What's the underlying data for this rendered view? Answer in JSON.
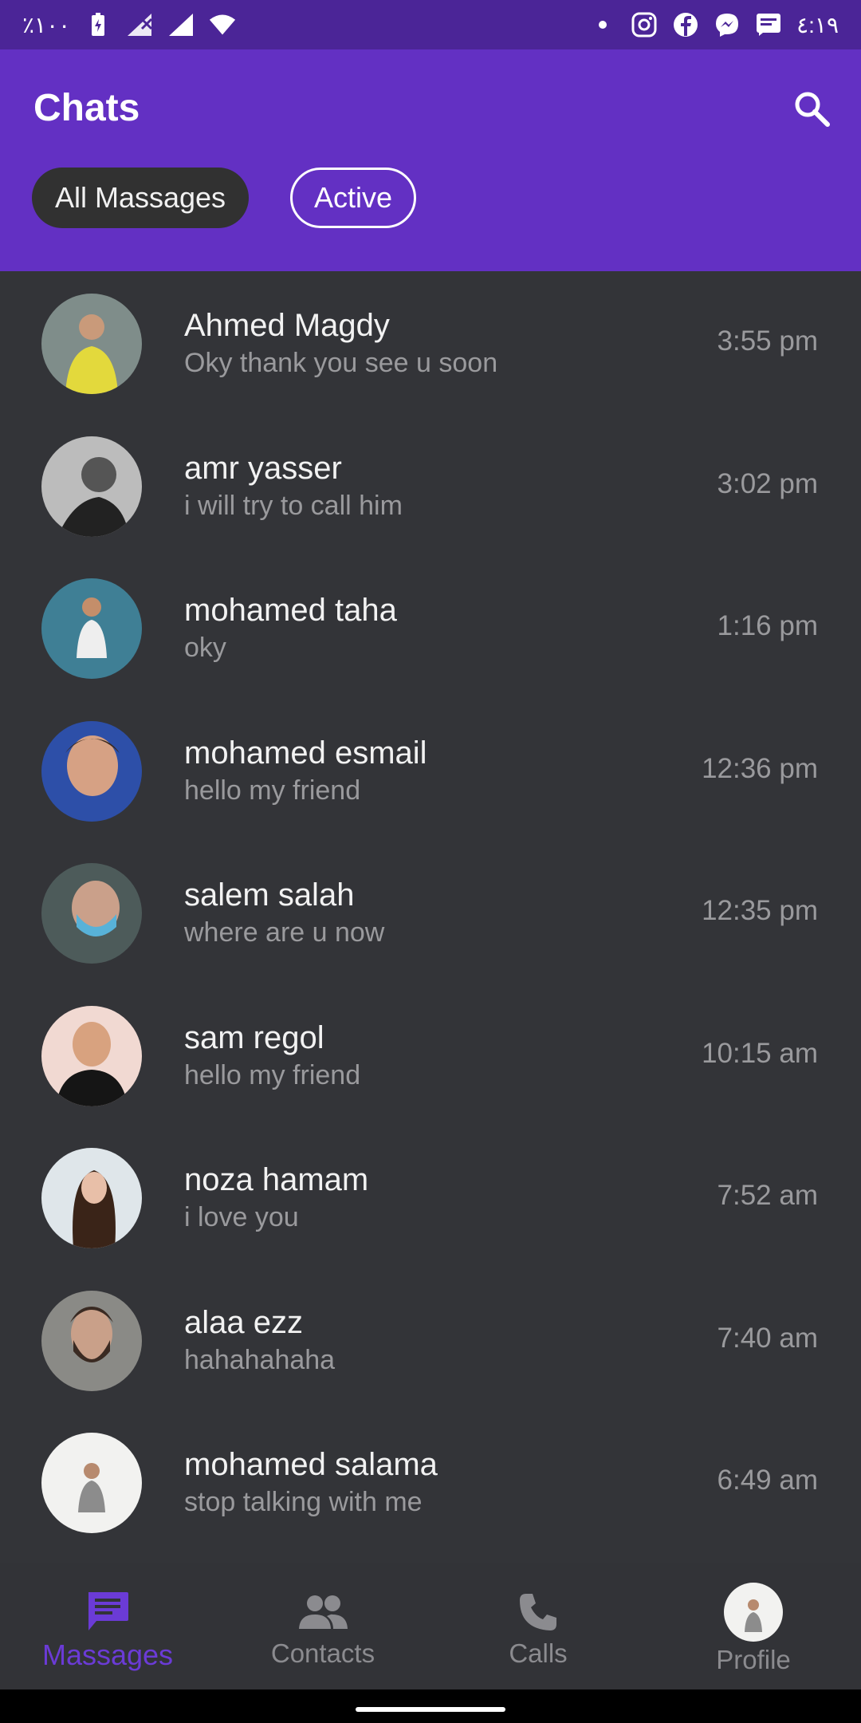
{
  "status_bar": {
    "battery": "٪١٠٠",
    "time": "٤:١٩",
    "left_icons": [
      "battery-icon",
      "signal-icon",
      "signal-icon",
      "wifi-icon"
    ],
    "right_icons": [
      "dot-icon",
      "instagram-icon",
      "facebook-icon",
      "messenger-icon",
      "message-icon"
    ]
  },
  "header": {
    "title": "Chats",
    "search_icon": "search-icon",
    "filters": [
      {
        "label": "All Massages",
        "selected": true
      },
      {
        "label": "Active",
        "selected": false
      }
    ]
  },
  "colors": {
    "status_bar": "#4b2597",
    "app_bar": "#6330c3",
    "background": "#333438",
    "accent": "#6b3bd6",
    "muted": "#9a9a9d"
  },
  "chats": [
    {
      "name": "Ahmed Magdy",
      "message": "Oky thank you see u soon",
      "time": "3:55 pm"
    },
    {
      "name": "amr yasser",
      "message": "i will try to call him",
      "time": "3:02 pm"
    },
    {
      "name": "mohamed taha",
      "message": "oky",
      "time": "1:16 pm"
    },
    {
      "name": "mohamed esmail",
      "message": "hello my friend",
      "time": "12:36 pm"
    },
    {
      "name": "salem salah",
      "message": "where are u now",
      "time": "12:35 pm"
    },
    {
      "name": "sam regol",
      "message": "hello my friend",
      "time": "10:15 am"
    },
    {
      "name": "noza hamam",
      "message": "i love you",
      "time": "7:52 am"
    },
    {
      "name": "alaa ezz",
      "message": "hahahahaha",
      "time": "7:40 am"
    },
    {
      "name": "mohamed salama",
      "message": "stop talking with me",
      "time": "6:49 am"
    }
  ],
  "bottom_nav": [
    {
      "label": "Massages",
      "icon": "chat-icon",
      "active": true
    },
    {
      "label": "Contacts",
      "icon": "contacts-icon",
      "active": false
    },
    {
      "label": "Calls",
      "icon": "phone-icon",
      "active": false
    },
    {
      "label": "Profile",
      "icon": "avatar",
      "active": false
    }
  ]
}
